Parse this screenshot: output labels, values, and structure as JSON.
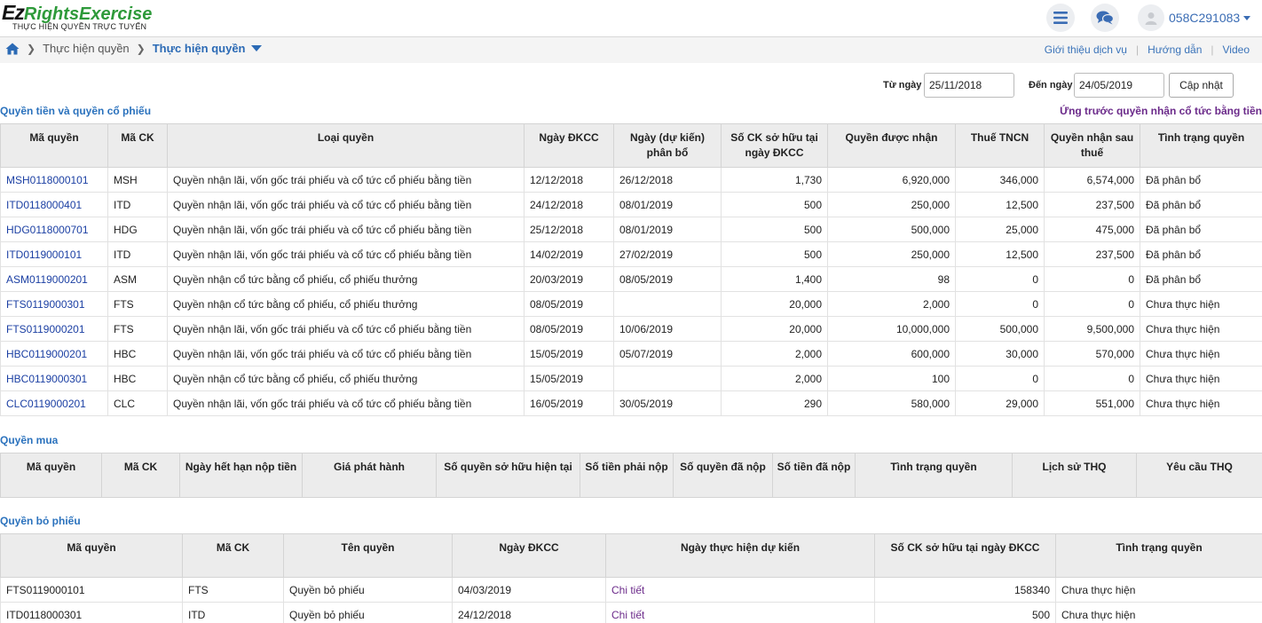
{
  "app": {
    "logo_prefix": "Ez",
    "logo_main": "RightsExercise",
    "logo_subtitle": "THỰC HIỆN QUYỀN TRỰC TUYẾN",
    "user_id": "058C291083"
  },
  "icons": {
    "menu": "hamburger-icon",
    "chat": "chat-bubbles-icon",
    "avatar": "user-avatar-icon",
    "home": "home-icon"
  },
  "breadcrumb": {
    "level1": "Thực hiện quyền",
    "level2": "Thực hiện quyền"
  },
  "top_links": [
    "Giới thiệu dịch vụ",
    "Hướng dẫn",
    "Video"
  ],
  "filter": {
    "from_label": "Từ ngày",
    "from_value": "25/11/2018",
    "to_label": "Đến ngày",
    "to_value": "24/05/2019",
    "update_label": "Cập nhật"
  },
  "cash_stock": {
    "title": "Quyền tiền và quyền cổ phiếu",
    "advance_link": "Ứng trước quyền nhận cổ tức bằng tiền",
    "headers": [
      "Mã quyền",
      "Mã CK",
      "Loại quyền",
      "Ngày ĐKCC",
      "Ngày (dự kiến) phân bổ",
      "Số CK sở hữu tại ngày ĐKCC",
      "Quyền được nhận",
      "Thuế TNCN",
      "Quyền nhận sau thuế",
      "Tình trạng quyền"
    ],
    "rows": [
      [
        "MSH0118000101",
        "MSH",
        "Quyền nhận lãi, vốn gốc trái phiếu và cổ tức cổ phiếu bằng tiền",
        "12/12/2018",
        "26/12/2018",
        "1,730",
        "6,920,000",
        "346,000",
        "6,574,000",
        "Đã phân bổ"
      ],
      [
        "ITD0118000401",
        "ITD",
        "Quyền nhận lãi, vốn gốc trái phiếu và cổ tức cổ phiếu bằng tiền",
        "24/12/2018",
        "08/01/2019",
        "500",
        "250,000",
        "12,500",
        "237,500",
        "Đã phân bổ"
      ],
      [
        "HDG0118000701",
        "HDG",
        "Quyền nhận lãi, vốn gốc trái phiếu và cổ tức cổ phiếu bằng tiền",
        "25/12/2018",
        "08/01/2019",
        "500",
        "500,000",
        "25,000",
        "475,000",
        "Đã phân bổ"
      ],
      [
        "ITD0119000101",
        "ITD",
        "Quyền nhận lãi, vốn gốc trái phiếu và cổ tức cổ phiếu bằng tiền",
        "14/02/2019",
        "27/02/2019",
        "500",
        "250,000",
        "12,500",
        "237,500",
        "Đã phân bổ"
      ],
      [
        "ASM0119000201",
        "ASM",
        "Quyền nhận cổ tức bằng cổ phiếu, cổ phiếu thưởng",
        "20/03/2019",
        "08/05/2019",
        "1,400",
        "98",
        "0",
        "0",
        "Đã phân bổ"
      ],
      [
        "FTS0119000301",
        "FTS",
        "Quyền nhận cổ tức bằng cổ phiếu, cổ phiếu thưởng",
        "08/05/2019",
        "",
        "20,000",
        "2,000",
        "0",
        "0",
        "Chưa thực hiện"
      ],
      [
        "FTS0119000201",
        "FTS",
        "Quyền nhận lãi, vốn gốc trái phiếu và cổ tức cổ phiếu bằng tiền",
        "08/05/2019",
        "10/06/2019",
        "20,000",
        "10,000,000",
        "500,000",
        "9,500,000",
        "Chưa thực hiện"
      ],
      [
        "HBC0119000201",
        "HBC",
        "Quyền nhận lãi, vốn gốc trái phiếu và cổ tức cổ phiếu bằng tiền",
        "15/05/2019",
        "05/07/2019",
        "2,000",
        "600,000",
        "30,000",
        "570,000",
        "Chưa thực hiện"
      ],
      [
        "HBC0119000301",
        "HBC",
        "Quyền nhận cổ tức bằng cổ phiếu, cổ phiếu thưởng",
        "15/05/2019",
        "",
        "2,000",
        "100",
        "0",
        "0",
        "Chưa thực hiện"
      ],
      [
        "CLC0119000201",
        "CLC",
        "Quyền nhận lãi, vốn gốc trái phiếu và cổ tức cổ phiếu bằng tiền",
        "16/05/2019",
        "30/05/2019",
        "290",
        "580,000",
        "29,000",
        "551,000",
        "Chưa thực hiện"
      ]
    ]
  },
  "purchase": {
    "title": "Quyền mua",
    "headers": [
      "Mã quyền",
      "Mã CK",
      "Ngày hết hạn nộp tiền",
      "Giá phát hành",
      "Số quyền sở hữu hiện tại",
      "Số tiền phải nộp",
      "Số quyền đã nộp",
      "Số tiền đã nộp",
      "Tình trạng quyền",
      "Lịch sử THQ",
      "Yêu cầu THQ"
    ]
  },
  "voting": {
    "title": "Quyền bỏ phiếu",
    "headers": [
      "Mã quyền",
      "Mã CK",
      "Tên quyền",
      "Ngày ĐKCC",
      "Ngày thực hiện dự kiến",
      "Số CK sở hữu tại ngày ĐKCC",
      "Tình trạng quyền"
    ],
    "rows": [
      [
        "FTS0119000101",
        "FTS",
        "Quyền bỏ phiếu",
        "04/03/2019",
        "Chi tiết",
        "158340",
        "Chưa thực hiện"
      ],
      [
        "ITD0118000301",
        "ITD",
        "Quyền bỏ phiếu",
        "24/12/2018",
        "Chi tiết",
        "500",
        "Chưa thực hiện"
      ]
    ]
  }
}
